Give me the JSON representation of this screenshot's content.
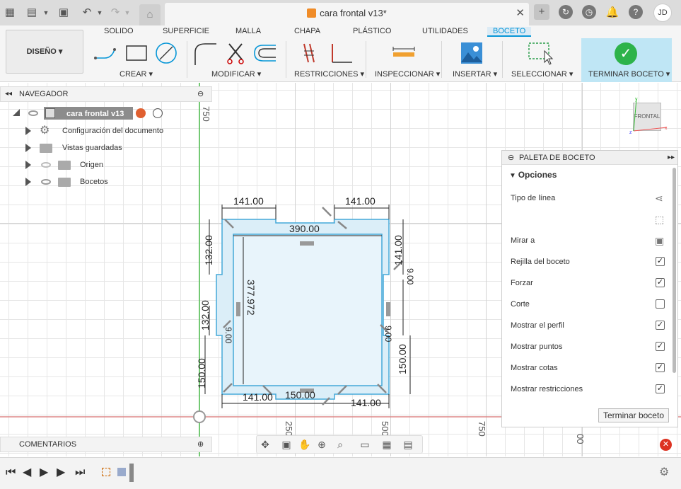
{
  "title_bar": {
    "doc_title": "cara frontal v13*",
    "avatar_initials": "JD"
  },
  "ribbon": {
    "workspace": "DISEÑO ▾",
    "tabs": [
      "SOLIDO",
      "SUPERFICIE",
      "MALLA",
      "CHAPA",
      "PLÁSTICO",
      "UTILIDADES",
      "BOCETO"
    ],
    "active_tab": "BOCETO",
    "groups": [
      "CREAR ▾",
      "MODIFICAR ▾",
      "RESTRICCIONES ▾",
      "INSPECCIONAR ▾",
      "INSERTAR ▾",
      "SELECCIONAR ▾",
      "TERMINAR BOCETO ▾"
    ]
  },
  "navigator": {
    "header": "NAVEGADOR",
    "root": "cara frontal v13",
    "items": [
      "Configuración del documento",
      "Vistas guardadas",
      "Origen",
      "Bocetos"
    ]
  },
  "comments": "COMENTARIOS",
  "viewcube": {
    "label": "FRONTAL"
  },
  "palette": {
    "title": "PALETA DE BOCETO",
    "section": "Opciones",
    "rows": [
      {
        "label": "Tipo de línea",
        "kind": "icon"
      },
      {
        "label": "",
        "kind": "icon"
      },
      {
        "label": "Mirar a",
        "kind": "icon"
      },
      {
        "label": "Rejilla del boceto",
        "kind": "check",
        "checked": true
      },
      {
        "label": "Forzar",
        "kind": "check",
        "checked": true
      },
      {
        "label": "Corte",
        "kind": "check",
        "checked": false
      },
      {
        "label": "Mostrar el perfil",
        "kind": "check",
        "checked": true
      },
      {
        "label": "Mostrar puntos",
        "kind": "check",
        "checked": true
      },
      {
        "label": "Mostrar cotas",
        "kind": "check",
        "checked": true
      },
      {
        "label": "Mostrar restricciones",
        "kind": "check",
        "checked": true
      }
    ],
    "finish_button": "Terminar boceto"
  },
  "sketch": {
    "dimensions": [
      "141.00",
      "141.00",
      "390.00",
      "377.972",
      "132.00",
      "132.00",
      "141.00",
      "150.00",
      "150.00",
      "141.00",
      "150.00",
      "141.00",
      "9.00",
      "9.00",
      "9.00"
    ],
    "axis_ticks": [
      "750",
      "250",
      "500",
      "750",
      "00"
    ]
  }
}
